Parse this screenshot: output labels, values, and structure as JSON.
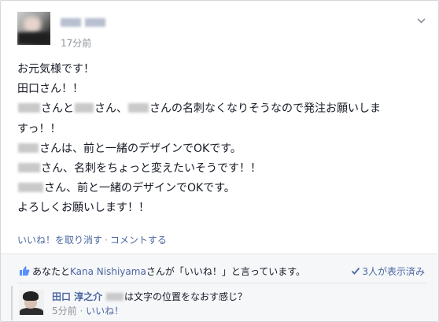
{
  "post": {
    "timestamp": "17分前",
    "lines": [
      {
        "parts": [
          "お元気様です！"
        ]
      },
      {
        "parts": [
          "田口さん！！"
        ]
      },
      {
        "parts": [
          "",
          "さんと",
          "",
          "さん、",
          "",
          "さんの名刺なくなりそうなので発注お願いしま"
        ]
      },
      {
        "parts": [
          "すっ！！"
        ]
      },
      {
        "parts": [
          "",
          "さんは、前と一緒のデザインでOKです。"
        ]
      },
      {
        "parts": [
          "",
          "さん、名刺をちょっと変えたいそうです！！"
        ]
      },
      {
        "parts": [
          "",
          "さん、前と一緒のデザインでOKです。"
        ]
      },
      {
        "parts": [
          "よろしくお願いします！！"
        ]
      }
    ]
  },
  "actions": {
    "unlike": "いいね！を取り消す",
    "separator": "·",
    "comment": "コメントする"
  },
  "likes": {
    "prefix": "あなたと",
    "liker": "Kana Nishiyama",
    "suffix": "さんが「いいね！」と言っています。",
    "seen": "3人が表示済み"
  },
  "comment": {
    "author": "田口 淳之介",
    "text": "は文字の位置をなおす感じ？",
    "time": "5分前",
    "separator": "·",
    "like": "いいね！"
  },
  "colors": {
    "link": "#4b67a1",
    "meta": "#90949c",
    "text": "#141823"
  },
  "icons": [
    "chevron-down-icon",
    "like-thumb-icon",
    "checkmark-icon"
  ]
}
